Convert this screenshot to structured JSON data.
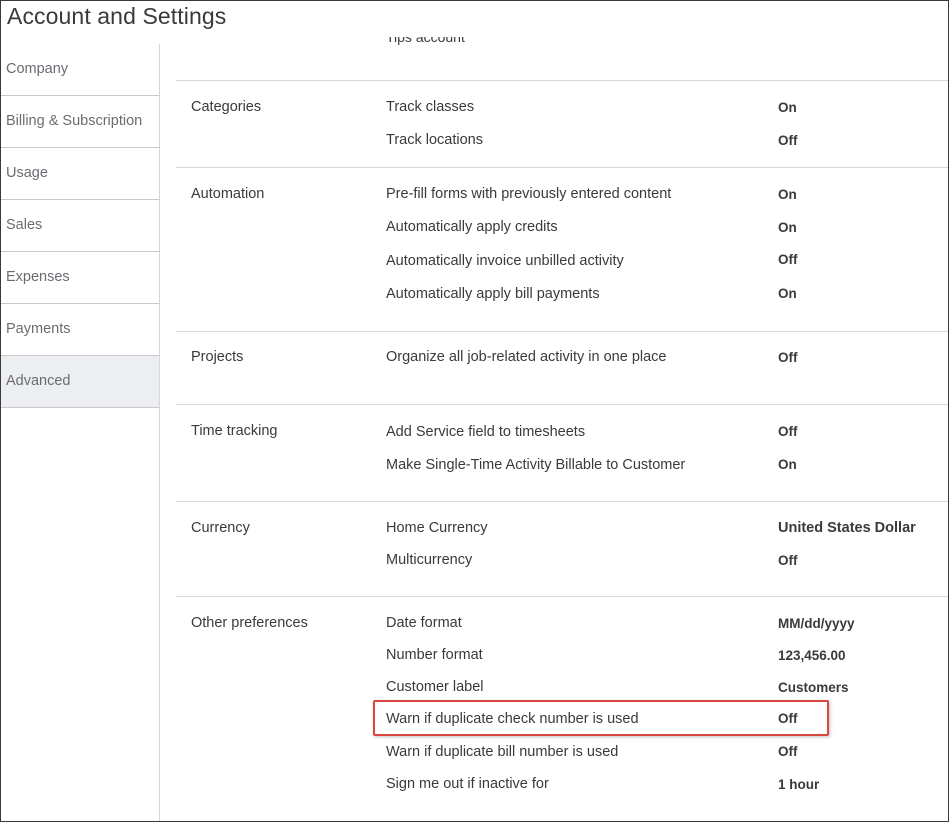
{
  "page": {
    "title": "Account and Settings"
  },
  "sidebar": {
    "items": [
      {
        "label": "Company"
      },
      {
        "label": "Billing & Subscription"
      },
      {
        "label": "Usage"
      },
      {
        "label": "Sales"
      },
      {
        "label": "Expenses"
      },
      {
        "label": "Payments"
      },
      {
        "label": "Advanced",
        "active": true
      }
    ]
  },
  "content": {
    "cut_off_text": "Tips account",
    "sections": [
      {
        "title": "Categories",
        "rows": [
          {
            "label": "Track classes",
            "value": "On"
          },
          {
            "label": "Track locations",
            "value": "Off"
          }
        ]
      },
      {
        "title": "Automation",
        "rows": [
          {
            "label": "Pre-fill forms with previously entered content",
            "value": "On"
          },
          {
            "label": "Automatically apply credits",
            "value": "On"
          },
          {
            "label": "Automatically invoice unbilled activity",
            "value": "Off"
          },
          {
            "label": "Automatically apply bill payments",
            "value": "On"
          }
        ]
      },
      {
        "title": "Projects",
        "rows": [
          {
            "label": "Organize all job-related activity in one place",
            "value": "Off"
          }
        ]
      },
      {
        "title": "Time tracking",
        "rows": [
          {
            "label": "Add Service field to timesheets",
            "value": "Off"
          },
          {
            "label": "Make Single-Time Activity Billable to Customer",
            "value": "On"
          }
        ]
      },
      {
        "title": "Currency",
        "rows": [
          {
            "label": "Home Currency",
            "value": "United States Dollar"
          },
          {
            "label": "Multicurrency",
            "value": "Off"
          }
        ]
      },
      {
        "title": "Other preferences",
        "rows": [
          {
            "label": "Date format",
            "value": "MM/dd/yyyy"
          },
          {
            "label": "Number format",
            "value": "123,456.00"
          },
          {
            "label": "Customer label",
            "value": "Customers"
          },
          {
            "label": "Warn if duplicate check number is used",
            "value": "Off",
            "highlighted": true
          },
          {
            "label": "Warn if duplicate bill number is used",
            "value": "Off"
          },
          {
            "label": "Sign me out if inactive for",
            "value": "1 hour"
          }
        ]
      }
    ]
  },
  "colors": {
    "highlight": "#d9473f",
    "active_bg": "#eceef1",
    "divider": "#d4d7dc"
  }
}
